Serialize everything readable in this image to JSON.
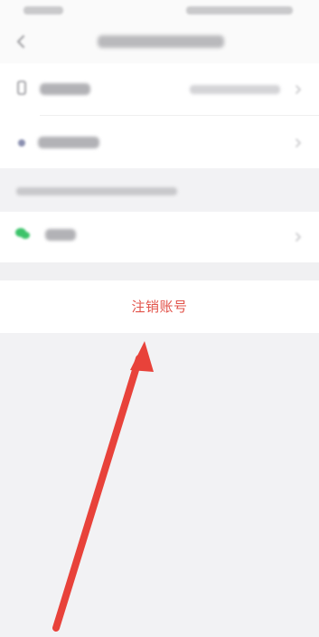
{
  "screen": {
    "title": "",
    "action": {
      "label": "注销账号",
      "color": "#e2534a"
    }
  },
  "annotation": {
    "type": "arrow",
    "color": "#e8423a",
    "points_to": "cancel-account-button"
  },
  "icons": {
    "back": "chevron-left-icon",
    "phone": "phone-icon",
    "password": "lock-icon",
    "wechat": "wechat-icon",
    "row_chevron": "chevron-right-icon"
  },
  "colors": {
    "background": "#f2f2f4",
    "row_background": "#ffffff",
    "wechat_green": "#3cc36a"
  }
}
